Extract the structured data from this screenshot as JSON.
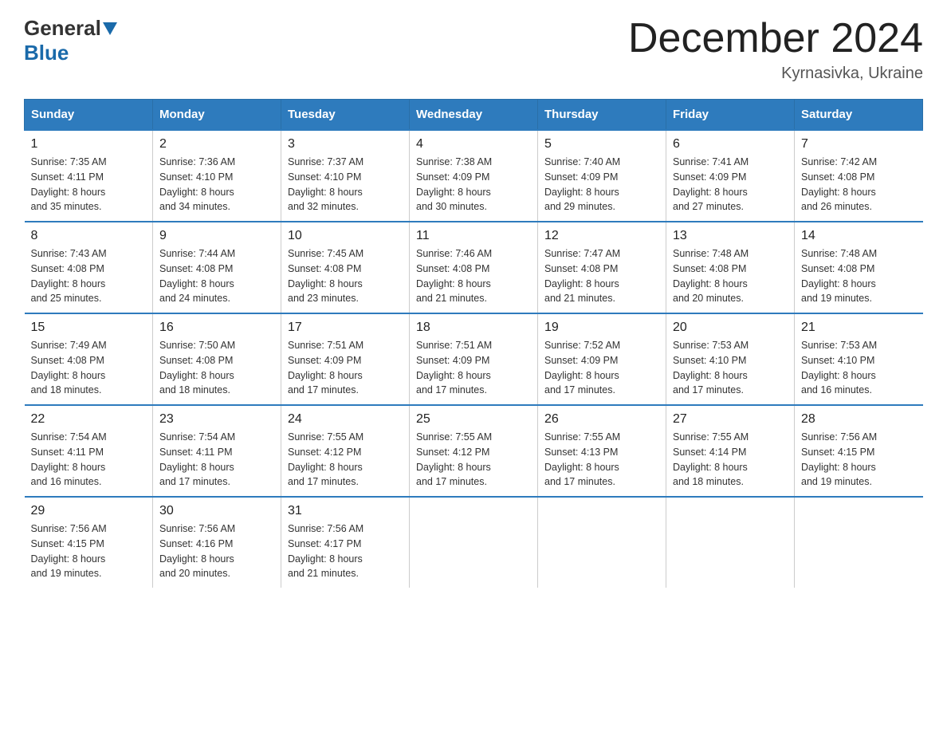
{
  "logo": {
    "general": "General",
    "blue": "Blue"
  },
  "title": "December 2024",
  "location": "Kyrnasivka, Ukraine",
  "weekdays": [
    "Sunday",
    "Monday",
    "Tuesday",
    "Wednesday",
    "Thursday",
    "Friday",
    "Saturday"
  ],
  "weeks": [
    [
      {
        "day": "1",
        "sunrise": "7:35 AM",
        "sunset": "4:11 PM",
        "daylight": "8 hours and 35 minutes."
      },
      {
        "day": "2",
        "sunrise": "7:36 AM",
        "sunset": "4:10 PM",
        "daylight": "8 hours and 34 minutes."
      },
      {
        "day": "3",
        "sunrise": "7:37 AM",
        "sunset": "4:10 PM",
        "daylight": "8 hours and 32 minutes."
      },
      {
        "day": "4",
        "sunrise": "7:38 AM",
        "sunset": "4:09 PM",
        "daylight": "8 hours and 30 minutes."
      },
      {
        "day": "5",
        "sunrise": "7:40 AM",
        "sunset": "4:09 PM",
        "daylight": "8 hours and 29 minutes."
      },
      {
        "day": "6",
        "sunrise": "7:41 AM",
        "sunset": "4:09 PM",
        "daylight": "8 hours and 27 minutes."
      },
      {
        "day": "7",
        "sunrise": "7:42 AM",
        "sunset": "4:08 PM",
        "daylight": "8 hours and 26 minutes."
      }
    ],
    [
      {
        "day": "8",
        "sunrise": "7:43 AM",
        "sunset": "4:08 PM",
        "daylight": "8 hours and 25 minutes."
      },
      {
        "day": "9",
        "sunrise": "7:44 AM",
        "sunset": "4:08 PM",
        "daylight": "8 hours and 24 minutes."
      },
      {
        "day": "10",
        "sunrise": "7:45 AM",
        "sunset": "4:08 PM",
        "daylight": "8 hours and 23 minutes."
      },
      {
        "day": "11",
        "sunrise": "7:46 AM",
        "sunset": "4:08 PM",
        "daylight": "8 hours and 21 minutes."
      },
      {
        "day": "12",
        "sunrise": "7:47 AM",
        "sunset": "4:08 PM",
        "daylight": "8 hours and 21 minutes."
      },
      {
        "day": "13",
        "sunrise": "7:48 AM",
        "sunset": "4:08 PM",
        "daylight": "8 hours and 20 minutes."
      },
      {
        "day": "14",
        "sunrise": "7:48 AM",
        "sunset": "4:08 PM",
        "daylight": "8 hours and 19 minutes."
      }
    ],
    [
      {
        "day": "15",
        "sunrise": "7:49 AM",
        "sunset": "4:08 PM",
        "daylight": "8 hours and 18 minutes."
      },
      {
        "day": "16",
        "sunrise": "7:50 AM",
        "sunset": "4:08 PM",
        "daylight": "8 hours and 18 minutes."
      },
      {
        "day": "17",
        "sunrise": "7:51 AM",
        "sunset": "4:09 PM",
        "daylight": "8 hours and 17 minutes."
      },
      {
        "day": "18",
        "sunrise": "7:51 AM",
        "sunset": "4:09 PM",
        "daylight": "8 hours and 17 minutes."
      },
      {
        "day": "19",
        "sunrise": "7:52 AM",
        "sunset": "4:09 PM",
        "daylight": "8 hours and 17 minutes."
      },
      {
        "day": "20",
        "sunrise": "7:53 AM",
        "sunset": "4:10 PM",
        "daylight": "8 hours and 17 minutes."
      },
      {
        "day": "21",
        "sunrise": "7:53 AM",
        "sunset": "4:10 PM",
        "daylight": "8 hours and 16 minutes."
      }
    ],
    [
      {
        "day": "22",
        "sunrise": "7:54 AM",
        "sunset": "4:11 PM",
        "daylight": "8 hours and 16 minutes."
      },
      {
        "day": "23",
        "sunrise": "7:54 AM",
        "sunset": "4:11 PM",
        "daylight": "8 hours and 17 minutes."
      },
      {
        "day": "24",
        "sunrise": "7:55 AM",
        "sunset": "4:12 PM",
        "daylight": "8 hours and 17 minutes."
      },
      {
        "day": "25",
        "sunrise": "7:55 AM",
        "sunset": "4:12 PM",
        "daylight": "8 hours and 17 minutes."
      },
      {
        "day": "26",
        "sunrise": "7:55 AM",
        "sunset": "4:13 PM",
        "daylight": "8 hours and 17 minutes."
      },
      {
        "day": "27",
        "sunrise": "7:55 AM",
        "sunset": "4:14 PM",
        "daylight": "8 hours and 18 minutes."
      },
      {
        "day": "28",
        "sunrise": "7:56 AM",
        "sunset": "4:15 PM",
        "daylight": "8 hours and 19 minutes."
      }
    ],
    [
      {
        "day": "29",
        "sunrise": "7:56 AM",
        "sunset": "4:15 PM",
        "daylight": "8 hours and 19 minutes."
      },
      {
        "day": "30",
        "sunrise": "7:56 AM",
        "sunset": "4:16 PM",
        "daylight": "8 hours and 20 minutes."
      },
      {
        "day": "31",
        "sunrise": "7:56 AM",
        "sunset": "4:17 PM",
        "daylight": "8 hours and 21 minutes."
      },
      null,
      null,
      null,
      null
    ]
  ],
  "labels": {
    "sunrise": "Sunrise:",
    "sunset": "Sunset:",
    "daylight": "Daylight:"
  }
}
